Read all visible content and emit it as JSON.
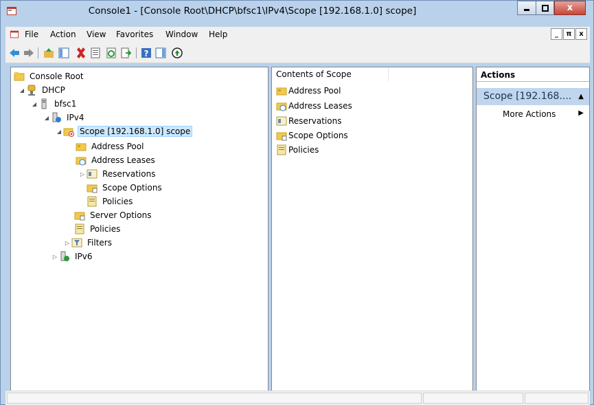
{
  "window": {
    "title": "Console1 - [Console Root\\DHCP\\bfsc1\\IPv4\\Scope [192.168.1.0] scope]",
    "controls": {
      "minimize": "minimize-icon",
      "maximize": "maximize-icon",
      "close": "x"
    }
  },
  "menubar": {
    "items": [
      "File",
      "Action",
      "View",
      "Favorites",
      "Window",
      "Help"
    ],
    "mdi": [
      "_",
      "π",
      "x"
    ]
  },
  "toolbar": {
    "buttons": [
      "back-icon",
      "forward-icon",
      "up-folder-icon",
      "show-hide-tree-icon",
      "delete-icon",
      "properties-icon",
      "refresh-icon",
      "export-list-icon",
      "help-icon",
      "show-hide-action-pane-icon",
      "add-icon"
    ]
  },
  "tree": {
    "root": "Console Root",
    "dhcp": "DHCP",
    "server": "bfsc1",
    "ipv4": "IPv4",
    "scope": "Scope [192.168.1.0] scope",
    "scope_children": [
      "Address Pool",
      "Address Leases",
      "Reservations",
      "Scope Options",
      "Policies"
    ],
    "server_options": "Server Options",
    "policies": "Policies",
    "filters": "Filters",
    "ipv6": "IPv6"
  },
  "contents": {
    "header": "Contents of Scope",
    "items": [
      "Address Pool",
      "Address Leases",
      "Reservations",
      "Scope Options",
      "Policies"
    ]
  },
  "actions": {
    "header": "Actions",
    "group": "Scope [192.168....",
    "more": "More Actions"
  },
  "colors": {
    "frame": "#b9d1ea",
    "selection": "#cce8ff",
    "actions_group": "#c0d6ee"
  }
}
